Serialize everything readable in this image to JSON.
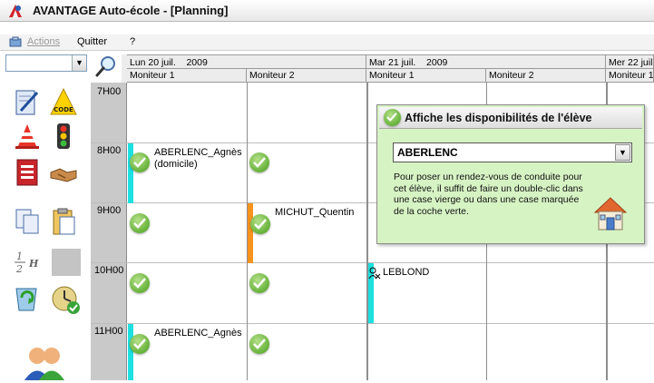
{
  "window": {
    "title": "AVANTAGE Auto-école - [Planning]"
  },
  "menu": {
    "actions": "Actions",
    "quitter": "Quitter",
    "help": "?"
  },
  "days": [
    {
      "date": "Lun 20 juil.",
      "year": "2009",
      "monitors": [
        "Moniteur 1",
        "Moniteur 2"
      ]
    },
    {
      "date": "Mar 21 juil.",
      "year": "2009",
      "monitors": [
        "Moniteur 1",
        "Moniteur 2"
      ]
    },
    {
      "date": "Mer 22 juil",
      "year": "",
      "monitors": [
        "Moniteur 1"
      ]
    }
  ],
  "hours": [
    "7H00",
    "8H00",
    "9H00",
    "10H00",
    "11H00"
  ],
  "entries": {
    "aberlenc_8": "ABERLENC_Agnès",
    "aberlenc_8_note": "(domicile)",
    "michut_9": "MICHUT_Quentin",
    "leblond_10": "LEBLOND",
    "aberlenc_11": "ABERLENC_Agnès"
  },
  "popup": {
    "title": "Affiche les disponibilités de l'élève",
    "student": "ABERLENC",
    "help_text": "Pour poser un rendez-vous de conduite pour cet élève, il suffit de faire un double-clic dans une case vierge ou dans une case marquée de la coche verte."
  },
  "colors": {
    "cyan": "#1ee0e0",
    "orange": "#f7931e",
    "green": "#5fae34",
    "popup_bg": "#d6f3c4"
  },
  "tools": [
    "edit-icon",
    "code-icon",
    "cone-icon",
    "traffic-light-icon",
    "document-icon",
    "handshake-icon",
    "copy-icon",
    "paste-icon",
    "fraction-icon",
    "blank-tool",
    "recycle-icon",
    "clock-check-icon",
    "users-icon"
  ]
}
